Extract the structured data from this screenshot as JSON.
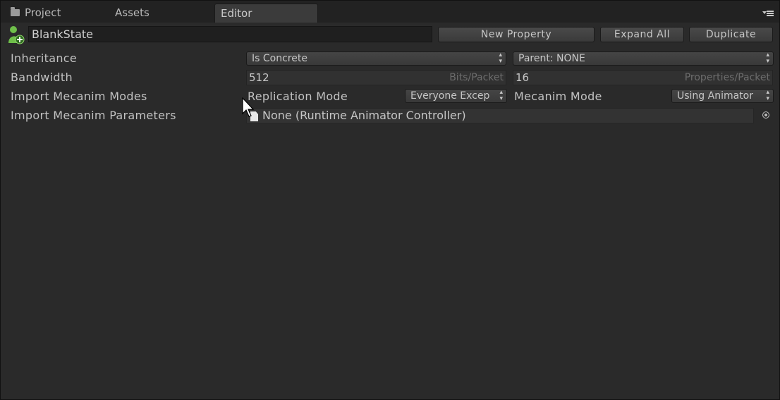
{
  "tabs": [
    {
      "label": "Project",
      "icon": "folder-icon"
    },
    {
      "label": "Assets"
    },
    {
      "label": "Editor",
      "active": true
    }
  ],
  "header": {
    "state_name": "BlankState",
    "new_property_label": "New Property",
    "expand_all_label": "Expand All",
    "duplicate_label": "Duplicate"
  },
  "rows": {
    "inheritance": {
      "label": "Inheritance",
      "mode_value": "Is Concrete",
      "parent_value": "Parent: NONE"
    },
    "bandwidth": {
      "label": "Bandwidth",
      "bits_value": "512",
      "bits_unit": "Bits/Packet",
      "props_value": "16",
      "props_unit": "Properties/Packet"
    },
    "mecanim_modes": {
      "label": "Import Mecanim Modes",
      "replication_label": "Replication Mode",
      "replication_value": "Everyone Excep",
      "mecanim_label": "Mecanim Mode",
      "mecanim_value": "Using Animator"
    },
    "mecanim_params": {
      "label": "Import Mecanim Parameters",
      "object_value": "None (Runtime Animator Controller)"
    }
  },
  "colors": {
    "panel_bg": "#2a2a2a",
    "tab_active": "#3b3b3b",
    "icon_green": "#6fbf4a"
  }
}
